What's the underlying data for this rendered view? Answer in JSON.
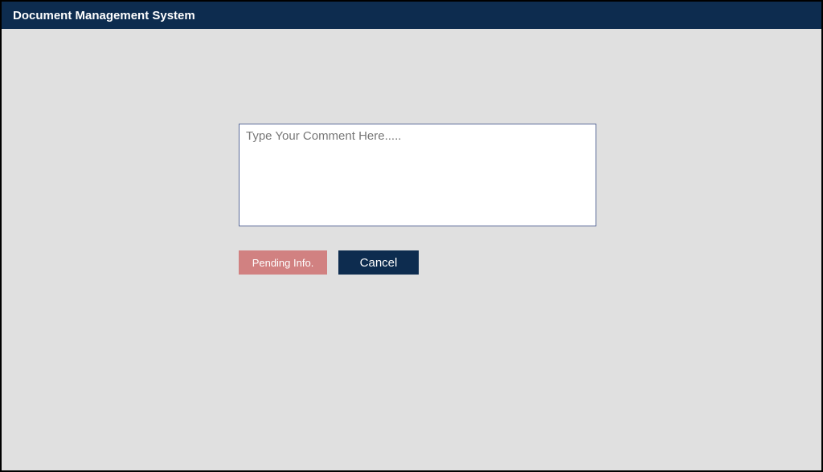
{
  "header": {
    "title": "Document Management System"
  },
  "comment_form": {
    "placeholder": "Type Your Comment Here.....",
    "value": ""
  },
  "buttons": {
    "pending_label": "Pending Info.",
    "cancel_label": "Cancel"
  }
}
